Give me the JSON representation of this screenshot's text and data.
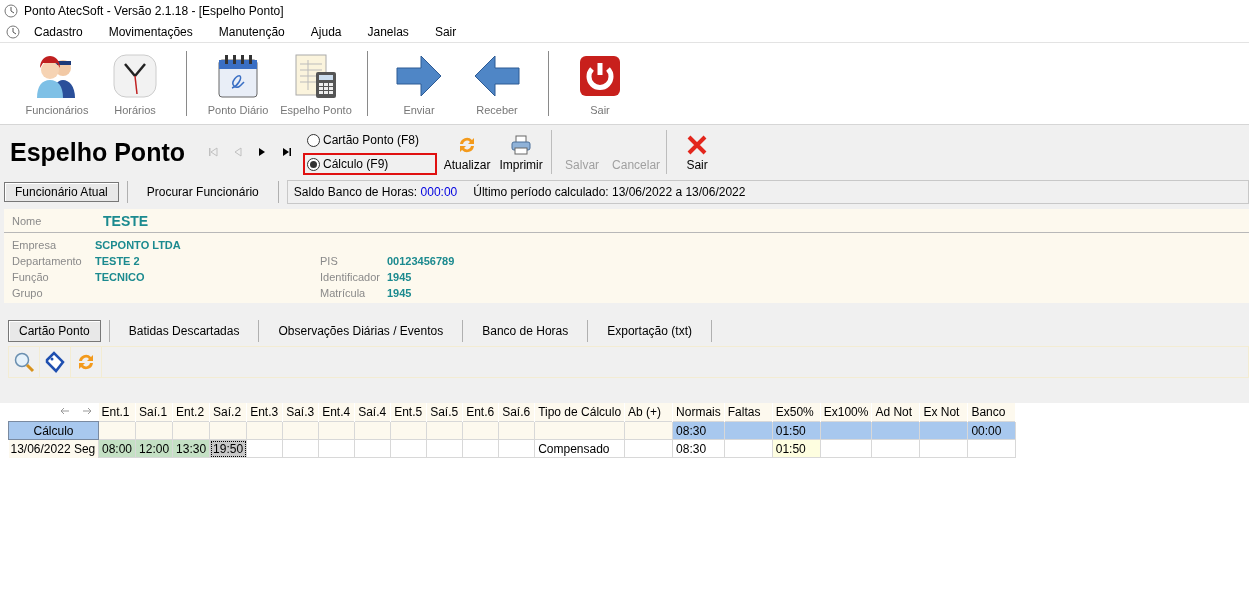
{
  "window": {
    "title": "Ponto AtecSoft - Versão 2.1.18 - [Espelho Ponto]"
  },
  "menu": [
    "Cadastro",
    "Movimentações",
    "Manutenção",
    "Ajuda",
    "Janelas",
    "Sair"
  ],
  "toolbar": [
    [
      {
        "label": "Funcionários",
        "kind": "staff"
      },
      {
        "label": "Horários",
        "kind": "clock"
      }
    ],
    [
      {
        "label": "Ponto Diário",
        "kind": "calendar"
      },
      {
        "label": "Espelho Ponto",
        "kind": "sheet"
      }
    ],
    [
      {
        "label": "Enviar",
        "kind": "send"
      },
      {
        "label": "Receber",
        "kind": "receive"
      }
    ],
    [
      {
        "label": "Sair",
        "kind": "power"
      }
    ]
  ],
  "form": {
    "title": "Espelho Ponto",
    "nav": [
      {
        "kind": "first",
        "disabled": true
      },
      {
        "kind": "prev",
        "disabled": true
      },
      {
        "kind": "next",
        "disabled": false
      },
      {
        "kind": "last",
        "disabled": false
      }
    ],
    "view_options": [
      {
        "label": "Cartão Ponto (F8)",
        "selected": false,
        "highlighted": false
      },
      {
        "label": "Cálculo (F9)",
        "selected": true,
        "highlighted": true
      }
    ],
    "actions": [
      [
        {
          "label": "Atualizar",
          "kind": "refresh",
          "disabled": false
        },
        {
          "label": "Imprimir",
          "kind": "print",
          "disabled": false
        }
      ],
      [
        {
          "label": "Salvar",
          "kind": "text",
          "disabled": true
        },
        {
          "label": "Cancelar",
          "kind": "text",
          "disabled": true
        }
      ],
      [
        {
          "label": "Sair",
          "kind": "close",
          "disabled": false
        }
      ]
    ]
  },
  "employee_tabs": [
    {
      "label": "Funcionário Atual",
      "selected": true
    },
    {
      "label": "Procurar Funcionário",
      "selected": false
    }
  ],
  "status": {
    "balance_label": "Saldo Banco de Horas:",
    "balance": "000:00",
    "period": "Último período calculado: 13/06/2022 a 13/06/2022"
  },
  "employee": {
    "name_label": "Nome",
    "name": "TESTE",
    "left": [
      {
        "label": "Empresa",
        "value": "SCPONTO LTDA"
      },
      {
        "label": "Departamento",
        "value": "TESTE 2"
      },
      {
        "label": "Função",
        "value": "TECNICO"
      },
      {
        "label": "Grupo"
      }
    ],
    "right": [
      {
        "label": "PIS",
        "value": "00123456789"
      },
      {
        "label": "Identificador",
        "value": "1945"
      },
      {
        "label": "Matrícula",
        "value": "1945"
      }
    ]
  },
  "tabs": [
    {
      "label": "Cartão Ponto",
      "selected": true
    },
    {
      "label": "Batidas Descartadas",
      "selected": false
    },
    {
      "label": "Observações Diárias / Eventos",
      "selected": false
    },
    {
      "label": "Banco de Horas",
      "selected": false
    },
    {
      "label": "Exportação (txt)",
      "selected": false
    }
  ],
  "tools": [
    {
      "kind": "search"
    },
    {
      "kind": "tag"
    },
    {
      "kind": "refresh"
    }
  ],
  "grid": {
    "columns": [
      {
        "label": "Ent.1",
        "kind": "punch"
      },
      {
        "label": "Saí.1",
        "kind": "punch"
      },
      {
        "label": "Ent.2",
        "kind": "punch"
      },
      {
        "label": "Saí.2",
        "kind": "punch"
      },
      {
        "label": "Ent.3",
        "kind": "punch"
      },
      {
        "label": "Saí.3",
        "kind": "punch"
      },
      {
        "label": "Ent.4",
        "kind": "punch"
      },
      {
        "label": "Saí.4",
        "kind": "punch"
      },
      {
        "label": "Ent.5",
        "kind": "punch"
      },
      {
        "label": "Saí.5",
        "kind": "punch"
      },
      {
        "label": "Ent.6",
        "kind": "punch"
      },
      {
        "label": "Saí.6",
        "kind": "punch"
      },
      {
        "label": "Tipo de Cálculo",
        "kind": "type"
      },
      {
        "label": "Ab (+)",
        "kind": "value"
      },
      {
        "label": "Normais",
        "kind": "value"
      },
      {
        "label": "Faltas",
        "kind": "value"
      },
      {
        "label": "Ex50%",
        "kind": "value"
      },
      {
        "label": "Ex100%",
        "kind": "value"
      },
      {
        "label": "Ad Not",
        "kind": "value"
      },
      {
        "label": "Ex Not",
        "kind": "value"
      },
      {
        "label": "Banco",
        "kind": "value"
      }
    ],
    "rows": [
      {
        "kind": "total",
        "label": "Cálculo",
        "cells": [
          {
            "kind": "plain"
          },
          {
            "kind": "plain"
          },
          {
            "kind": "plain"
          },
          {
            "kind": "plain"
          },
          {
            "kind": "plain"
          },
          {
            "kind": "plain"
          },
          {
            "kind": "plain"
          },
          {
            "kind": "plain"
          },
          {
            "kind": "plain"
          },
          {
            "kind": "plain"
          },
          {
            "kind": "plain"
          },
          {
            "kind": "plain"
          },
          {
            "kind": "plain"
          },
          {
            "kind": "plain"
          },
          {
            "kind": "total",
            "text": "08:30"
          },
          {
            "kind": "total"
          },
          {
            "kind": "total",
            "text": "01:50"
          },
          {
            "kind": "total"
          },
          {
            "kind": "total"
          },
          {
            "kind": "total"
          },
          {
            "kind": "total",
            "text": "00:00"
          }
        ]
      },
      {
        "kind": "day",
        "label": "13/06/2022 Seg",
        "cells": [
          {
            "kind": "punch",
            "text": "08:00"
          },
          {
            "kind": "punch",
            "text": "12:00"
          },
          {
            "kind": "punch",
            "text": "13:30"
          },
          {
            "kind": "focused",
            "text": "19:50"
          },
          {
            "kind": "plain"
          },
          {
            "kind": "plain"
          },
          {
            "kind": "plain"
          },
          {
            "kind": "plain"
          },
          {
            "kind": "plain"
          },
          {
            "kind": "plain"
          },
          {
            "kind": "plain"
          },
          {
            "kind": "plain"
          },
          {
            "kind": "plain",
            "text": "Compensado"
          },
          {
            "kind": "plain"
          },
          {
            "kind": "plain",
            "text": "08:30"
          },
          {
            "kind": "plain"
          },
          {
            "kind": "highlight",
            "text": "01:50"
          },
          {
            "kind": "plain"
          },
          {
            "kind": "plain"
          },
          {
            "kind": "plain"
          },
          {
            "kind": "plain"
          }
        ]
      }
    ]
  }
}
